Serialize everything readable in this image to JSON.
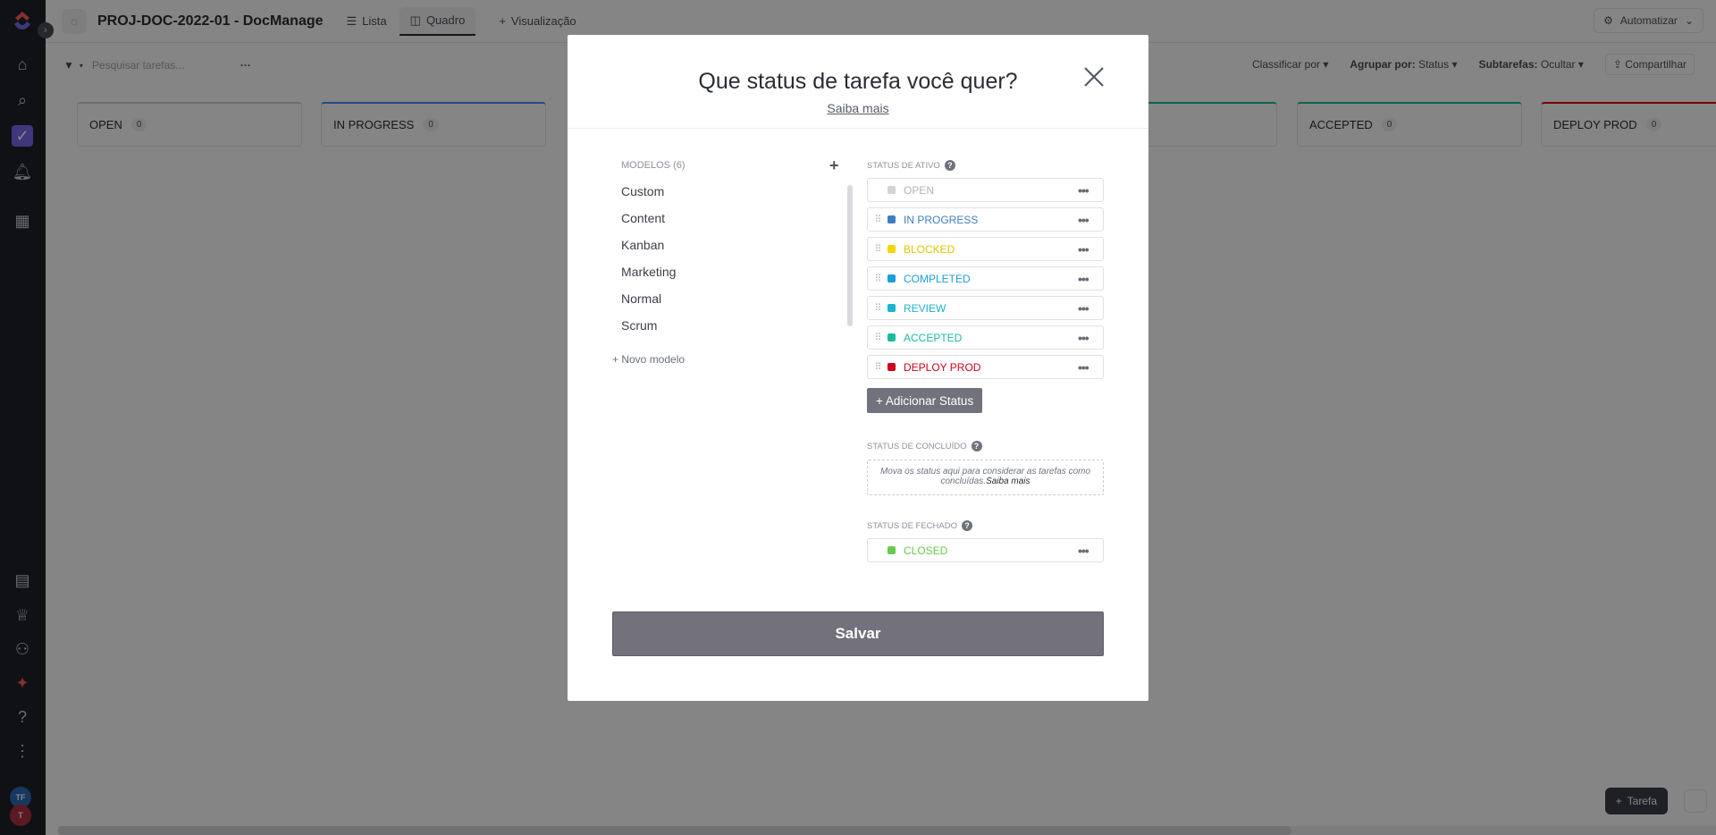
{
  "app": {
    "project_title": "PROJ-DOC-2022-01 - DocManage",
    "views": [
      {
        "label": "Lista",
        "icon": "list-icon"
      },
      {
        "label": "Quadro",
        "icon": "board-icon"
      },
      {
        "label": "Visualização",
        "icon": "plus-icon"
      }
    ],
    "automate_label": "Automatizar"
  },
  "toolbar": {
    "search_placeholder": "Pesquisar tarefas...",
    "sort_label": "Classificar por",
    "group_label": "Agrupar por:",
    "group_value": "Status",
    "subtasks_label": "Subtarefas:",
    "subtasks_value": "Ocultar",
    "share_label": "Compartilhar"
  },
  "board": {
    "columns": [
      {
        "name": "OPEN",
        "count": "0",
        "color": "#d3d3d3"
      },
      {
        "name": "IN PROGRESS",
        "count": "0",
        "color": "#4194f6"
      },
      {
        "name": "ACCEPTED",
        "count": "0",
        "color": "#1bbc9c"
      },
      {
        "name": "DEPLOY PROD",
        "count": "0",
        "color": "#e50000"
      }
    ],
    "new_task_label": "Tarefa"
  },
  "rail": {
    "avatar1_initials": "TF",
    "avatar2_initials": "T"
  },
  "modal": {
    "title": "Que status de tarefa você quer?",
    "learn_more": "Saiba mais",
    "templates_heading": "MODELOS (6)",
    "templates": [
      "Custom",
      "Content",
      "Kanban",
      "Marketing",
      "Normal",
      "Scrum"
    ],
    "new_template": "+ Novo modelo",
    "active_heading": "STATUS DE ATIVO",
    "active_statuses": [
      {
        "label": "OPEN",
        "color": "#d3d3d3",
        "text_color": "#b0b3b9"
      },
      {
        "label": "IN PROGRESS",
        "color": "#3f7fbf",
        "text_color": "#3f7fbf"
      },
      {
        "label": "BLOCKED",
        "color": "#f2d600",
        "text_color": "#e2c400"
      },
      {
        "label": "COMPLETED",
        "color": "#1e9fdc",
        "text_color": "#1e9fdc"
      },
      {
        "label": "REVIEW",
        "color": "#1bb5cc",
        "text_color": "#1bb5cc"
      },
      {
        "label": "ACCEPTED",
        "color": "#1bbc9c",
        "text_color": "#1bbc9c"
      },
      {
        "label": "DEPLOY PROD",
        "color": "#d0021b",
        "text_color": "#d0021b"
      }
    ],
    "add_status": "+ Adicionar Status",
    "done_heading": "STATUS DE CONCLUÍDO",
    "done_hint": "Mova os status aqui para considerar as tarefas como concluídas.",
    "done_hint_link": "Saiba mais",
    "closed_heading": "STATUS DE FECHADO",
    "closed_status": {
      "label": "CLOSED",
      "color": "#6bc950",
      "text_color": "#6bc950"
    },
    "save_label": "Salvar"
  }
}
